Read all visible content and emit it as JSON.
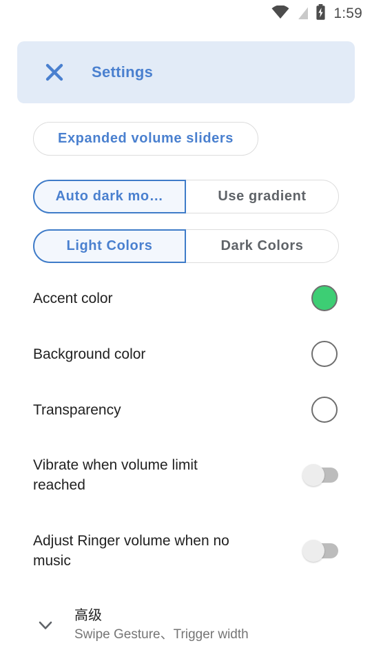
{
  "status_bar": {
    "icons": [
      "wifi-icon",
      "signal-off-icon",
      "battery-charging-icon"
    ],
    "time": "1:59"
  },
  "header": {
    "close_icon": "close-icon",
    "title": "Settings",
    "background_color": "#E2EBF7",
    "accent_color": "#4A80CF"
  },
  "pill_button": {
    "label": "Expanded volume sliders"
  },
  "segmented_groups": [
    {
      "name": "dark-mode-group",
      "options": [
        {
          "label": "Auto dark mo…",
          "selected": true
        },
        {
          "label": "Use gradient",
          "selected": false
        }
      ]
    },
    {
      "name": "color-scheme-group",
      "options": [
        {
          "label": "Light Colors",
          "selected": true
        },
        {
          "label": "Dark Colors",
          "selected": false
        }
      ]
    }
  ],
  "color_rows": [
    {
      "label": "Accent color",
      "swatch_color": "#3DCE74",
      "filled": true
    },
    {
      "label": "Background color",
      "swatch_color": "#FFFFFF",
      "filled": false
    },
    {
      "label": "Transparency",
      "swatch_color": "#FFFFFF",
      "filled": false
    }
  ],
  "switch_rows": [
    {
      "label": "Vibrate when volume limit reached",
      "on": false
    },
    {
      "label": "Adjust Ringer volume when no music",
      "on": false
    }
  ],
  "advanced": {
    "expand_icon": "chevron-down-icon",
    "title": "高级",
    "subtitle": "Swipe Gesture、Trigger width"
  }
}
